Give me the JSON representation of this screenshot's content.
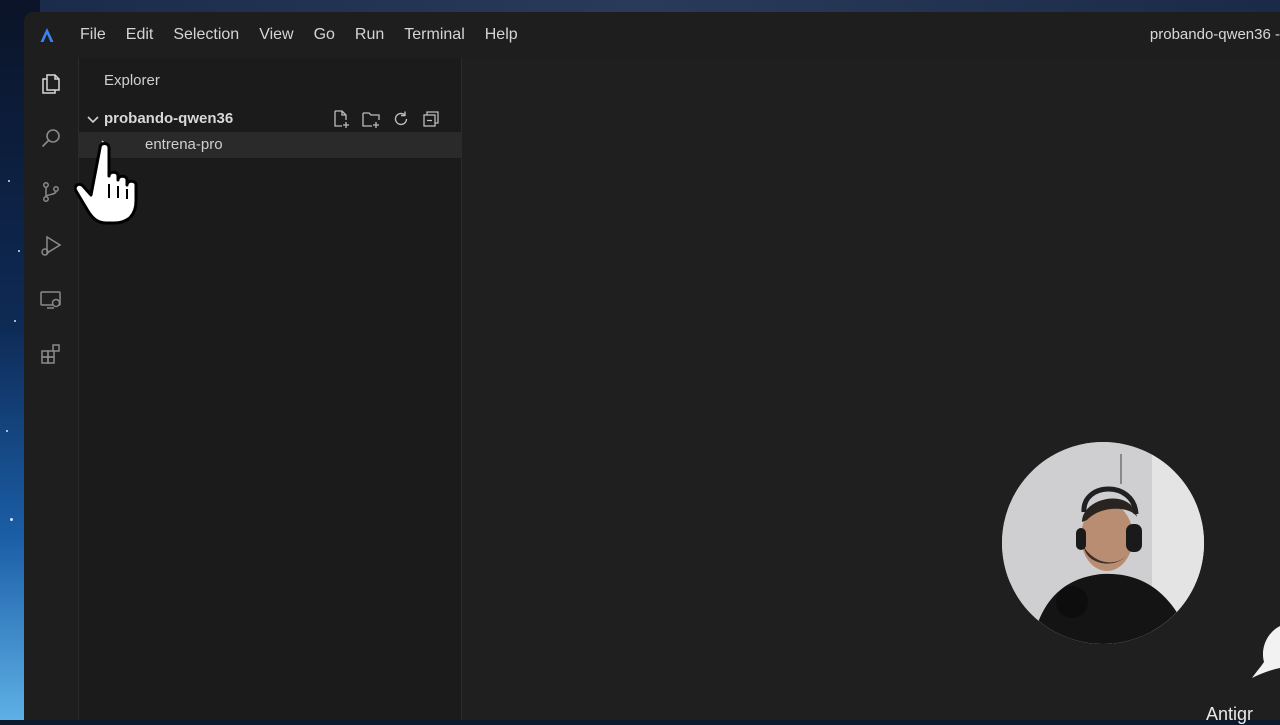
{
  "menu": [
    "File",
    "Edit",
    "Selection",
    "View",
    "Go",
    "Run",
    "Terminal",
    "Help"
  ],
  "window_title": "probando-qwen36 -",
  "activity_bar": [
    "explorer-icon",
    "search-icon",
    "source-control-icon",
    "run-debug-icon",
    "remote-explorer-icon",
    "extensions-icon"
  ],
  "sidebar": {
    "header": "Explorer",
    "folder": "probando-qwen36",
    "folder_actions": [
      "new-file-icon",
      "new-folder-icon",
      "refresh-icon",
      "collapse-all-icon"
    ],
    "items": [
      {
        "label": "entrena-pro",
        "type": "folder"
      }
    ]
  },
  "corner_text": "Antigr",
  "colors": {
    "accent": "#3b82f6",
    "background": "#1e1e1e",
    "sidebar": "#1b1b1b"
  }
}
